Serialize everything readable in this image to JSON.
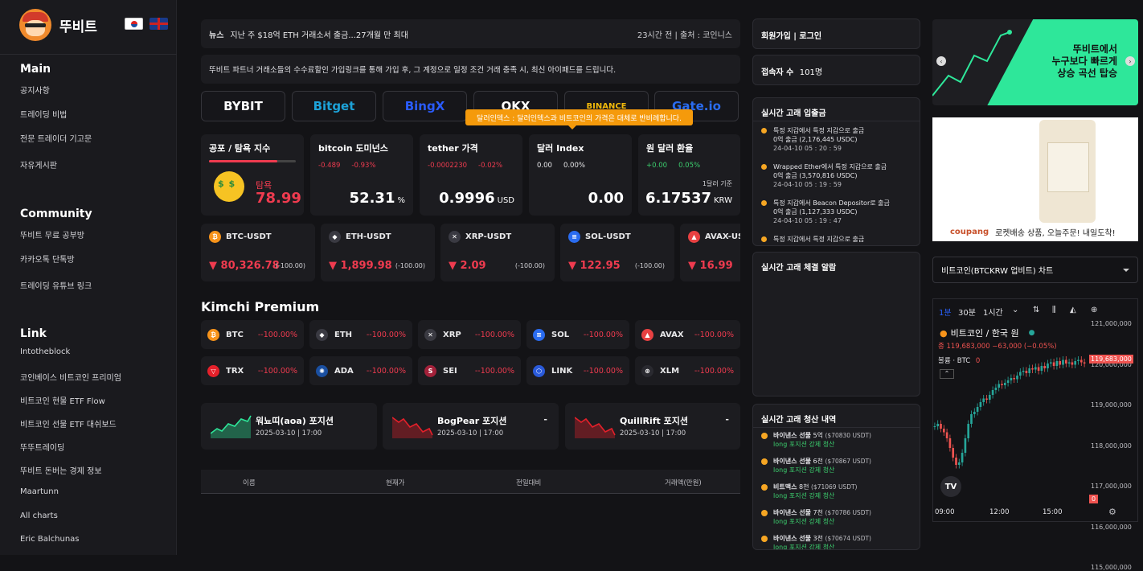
{
  "brand": {
    "name": "뚜비트"
  },
  "sidebar": {
    "sections": [
      {
        "title": "Main",
        "items": [
          "공지사항",
          "트레이딩 비법",
          "전문 트레이더 기고문",
          "자유게시판"
        ]
      },
      {
        "title": "Community",
        "items": [
          "뚜비트 무료 공부방",
          "카카오톡 단톡방",
          "트레이딩 유튜브 링크"
        ]
      },
      {
        "title": "Link",
        "items": [
          "Intotheblock",
          "코인베이스 비트코인 프리미엄",
          "비트코인 현물 ETF Flow",
          "비트코인 선물 ETF 대쉬보드",
          "뚜뚜트레이딩",
          "뚜비트 돈버는 경제 정보",
          "Maartunn",
          "All charts",
          "Eric Balchunas"
        ]
      }
    ]
  },
  "news": {
    "tag": "뉴스",
    "headline": "지난 주 $18억 ETH 거래소서 출금...27개월 만 최대",
    "meta": "23시간 전 | 출처 : 코인니스"
  },
  "promo": "뚜비트 파트너 거래소들의 수수료할인 가입링크를 통해 가입 후, 그 계정으로 일정 조건 거래 충족 시, 최신 아이패드를 드립니다.",
  "exchanges": [
    {
      "name": "BYBIT",
      "color": "#ffffff"
    },
    {
      "name": "Bitget",
      "color": "#1da2d8"
    },
    {
      "name": "BingX",
      "color": "#2a5cff"
    },
    {
      "name": "OKX",
      "color": "#ffffff"
    },
    {
      "name": "BINANCE",
      "color": "#f0b90b"
    },
    {
      "name": "Gate.io",
      "color": "#2a6cf0"
    }
  ],
  "tooltip": "달러인덱스 : 달러인덱스과 비트코인의 가격은 대체로 반비례합니다.",
  "stats": {
    "fear": {
      "title": "공포 / 탐욕 지수",
      "label": "탐욕",
      "value": "78.99",
      "level": 0.79
    },
    "dominance": {
      "title": "bitcoin 도미넌스",
      "c1": "-0.489",
      "c2": "-0.93%",
      "value": "52.31",
      "unit": "%"
    },
    "tether": {
      "title": "tether 가격",
      "c1": "-0.0002230",
      "c2": "-0.02%",
      "value": "0.9996",
      "unit": "USD"
    },
    "dxy": {
      "title": "달러 Index",
      "c1": "0.00",
      "c2": "0.00%",
      "value": "0.00"
    },
    "krw": {
      "title": "원 달러 환율",
      "c1": "+0.00",
      "c2": "0.05%",
      "note": "1달러 기준",
      "value": "6.17537",
      "unit": "KRW"
    }
  },
  "coins": [
    {
      "pair": "BTC-USDT",
      "price": "▼ 80,326.78",
      "pct": "(-100.00)",
      "color": "#f7931a",
      "sym": "₿"
    },
    {
      "pair": "ETH-USDT",
      "price": "▼ 1,899.98",
      "pct": "(-100.00)",
      "color": "#3a3a42",
      "sym": "◆"
    },
    {
      "pair": "XRP-USDT",
      "price": "▼ 2.09",
      "pct": "(-100.00)",
      "color": "#3a3a42",
      "sym": "✕"
    },
    {
      "pair": "SOL-USDT",
      "price": "▼ 122.95",
      "pct": "(-100.00)",
      "color": "#2a6cf0",
      "sym": "≡"
    },
    {
      "pair": "AVAX-USDT",
      "price": "▼ 16.99",
      "pct": "(-100.00)",
      "color": "#e84142",
      "sym": "▲"
    }
  ],
  "kimchi": {
    "title": "Kimchi Premium",
    "items": [
      {
        "sym": "BTC",
        "val": "--100.00%",
        "color": "#f7931a",
        "g": "₿"
      },
      {
        "sym": "ETH",
        "val": "--100.00%",
        "color": "#3a3a42",
        "g": "◆"
      },
      {
        "sym": "XRP",
        "val": "--100.00%",
        "color": "#3a3a42",
        "g": "✕"
      },
      {
        "sym": "SOL",
        "val": "--100.00%",
        "color": "#2a6cf0",
        "g": "≡"
      },
      {
        "sym": "AVAX",
        "val": "--100.00%",
        "color": "#e84142",
        "g": "▲"
      },
      {
        "sym": "TRX",
        "val": "--100.00%",
        "color": "#e5202a",
        "g": "▽"
      },
      {
        "sym": "ADA",
        "val": "--100.00%",
        "color": "#1a4fa0",
        "g": "✺"
      },
      {
        "sym": "SEI",
        "val": "--100.00%",
        "color": "#a3213a",
        "g": "S"
      },
      {
        "sym": "LINK",
        "val": "--100.00%",
        "color": "#2a5ada",
        "g": "⬡"
      },
      {
        "sym": "XLM",
        "val": "--100.00%",
        "color": "#2a2a30",
        "g": "⊛"
      }
    ]
  },
  "positions": [
    {
      "title": "워뇨띠(aoa) 포지션",
      "date": "2025-03-10 | 17:00",
      "trend": "up",
      "dash": ""
    },
    {
      "title": "BogPear 포지션",
      "date": "2025-03-10 | 17:00",
      "trend": "down",
      "dash": "-"
    },
    {
      "title": "QuillRift 포지션",
      "date": "2025-03-10 | 17:00",
      "trend": "down",
      "dash": "-"
    }
  ],
  "table": {
    "headers": [
      "이름",
      "현재가",
      "전일대비",
      "거래액(만원)"
    ]
  },
  "right": {
    "login": "회원가입 | 로그인",
    "visitors_label": "접속자 수",
    "visitors": "101명",
    "whale_io": {
      "title": "실시간 고래 입출금",
      "items": [
        {
          "text": "특정 지갑에서 특정 지갑으로 출금",
          "amt": "0억 출금 (2,176,445 USDC)",
          "time": "24-04-10 05 : 20 : 59"
        },
        {
          "text": "Wrapped Ether에서 특정 지갑으로 출금",
          "amt": "0억 출금 (3,570,816 USDC)",
          "time": "24-04-10 05 : 19 : 59"
        },
        {
          "text": "특정 지갑에서 Beacon Depositor로 출금",
          "amt": "0억 출금 (1,127,333 USDC)",
          "time": "24-04-10 05 : 19 : 47"
        },
        {
          "text": "특정 지갑에서 특정 지갑으로 출금",
          "amt": "",
          "time": ""
        }
      ]
    },
    "whale_trade": {
      "title": "실시간 고래 체결 알람"
    },
    "liq": {
      "title": "실시간 고래 청산 내역",
      "items": [
        {
          "ex": "바이낸스 선물",
          "amt": "5억",
          "usd": "($70830 USDT)",
          "desc": "long 포지션 강제 청산"
        },
        {
          "ex": "바이낸스 선물",
          "amt": "6천",
          "usd": "($70867 USDT)",
          "desc": "long 포지션 강제 청산"
        },
        {
          "ex": "비트맥스",
          "amt": "8천",
          "usd": "($71069 USDT)",
          "desc": "long 포지션 강제 청산"
        },
        {
          "ex": "바이낸스 선물",
          "amt": "7천",
          "usd": "($70786 USDT)",
          "desc": "long 포지션 강제 청산"
        },
        {
          "ex": "바이낸스 선물",
          "amt": "3천",
          "usd": "($70674 USDT)",
          "desc": "long 포지션 강제 청산"
        }
      ]
    }
  },
  "ads": {
    "green": [
      "뚜비트에서",
      "누구보다 빠르게",
      "상승 곡선 탑승"
    ],
    "coupang_logo": "coupang",
    "coupang_text": "로켓배송 상품, 오늘주문! 내일도착!"
  },
  "chart": {
    "select": "비트코인(BTCKRW 업비트) 차트",
    "intervals": [
      "1분",
      "30분",
      "1시간"
    ],
    "title": "비트코인 / 한국 원",
    "ohlc": "종 119,683,000  −63,000 (−0.05%)",
    "volume_label": "볼륨 · BTC",
    "volume_val": "0",
    "last_price": "119,683,000",
    "yaxis": [
      "121,000,000",
      "120,000,000",
      "119,000,000",
      "118,000,000",
      "117,000,000",
      "116,000,000",
      "115,000,000"
    ],
    "xaxis": [
      "09:00",
      "12:00",
      "15:00"
    ],
    "vol_last": "0",
    "up": "#26a69a",
    "down": "#ef5350"
  }
}
